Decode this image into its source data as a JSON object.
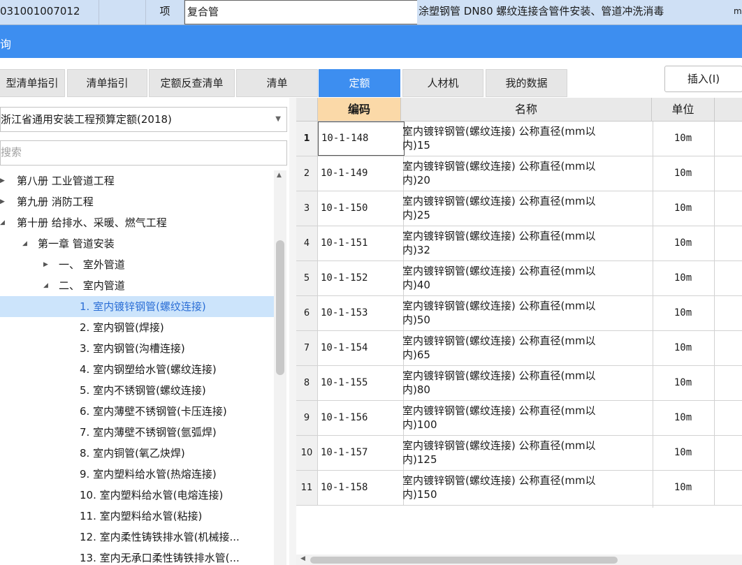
{
  "top_row": {
    "code": "031001007012",
    "blank": "",
    "unit_type": "项",
    "name": "复合管",
    "description": "涂塑钢管 DN80 螺纹连接含管件安装、管道冲洗消毒",
    "extra": "m"
  },
  "title_bar": {
    "title": "询"
  },
  "tabs": [
    {
      "label": "型清单指引"
    },
    {
      "label": "清单指引"
    },
    {
      "label": "定额反查清单"
    },
    {
      "label": "清单"
    },
    {
      "label": "定额"
    },
    {
      "label": "人材机"
    },
    {
      "label": "我的数据"
    }
  ],
  "insert_button": {
    "label": "插入(I)"
  },
  "quota_select": {
    "value": "浙江省通用安装工程预算定额(2018)"
  },
  "search": {
    "placeholder": "搜索"
  },
  "tree": [
    {
      "label": "第八册 工业管道工程",
      "arrow": "▶"
    },
    {
      "label": "第九册 消防工程",
      "arrow": "▶"
    },
    {
      "label": "第十册 给排水、采暖、燃气工程",
      "arrow": "◢"
    },
    {
      "label": "第一章 管道安装",
      "arrow": "◢"
    },
    {
      "label": "一、 室外管道",
      "arrow": "▶"
    },
    {
      "label": "二、 室内管道",
      "arrow": "◢"
    },
    {
      "label": "1. 室内镀锌钢管(螺纹连接)",
      "arrow": ""
    },
    {
      "label": "2. 室内钢管(焊接)",
      "arrow": ""
    },
    {
      "label": "3. 室内钢管(沟槽连接)",
      "arrow": ""
    },
    {
      "label": "4. 室内钢塑给水管(螺纹连接)",
      "arrow": ""
    },
    {
      "label": "5. 室内不锈钢管(螺纹连接)",
      "arrow": ""
    },
    {
      "label": "6. 室内薄壁不锈钢管(卡压连接)",
      "arrow": ""
    },
    {
      "label": "7. 室内薄壁不锈钢管(氩弧焊)",
      "arrow": ""
    },
    {
      "label": "8. 室内铜管(氧乙炔焊)",
      "arrow": ""
    },
    {
      "label": "9. 室内塑料给水管(热熔连接)",
      "arrow": ""
    },
    {
      "label": "10. 室内塑料给水管(电熔连接)",
      "arrow": ""
    },
    {
      "label": "11. 室内塑料给水管(粘接)",
      "arrow": ""
    },
    {
      "label": "12. 室内柔性铸铁排水管(机械接...",
      "arrow": ""
    },
    {
      "label": "13. 室内无承口柔性铸铁排水管(...",
      "arrow": ""
    }
  ],
  "grid": {
    "headers": {
      "num": "",
      "code": "编码",
      "name": "名称",
      "unit": "单位"
    },
    "rows": [
      {
        "num": "1",
        "code": "10-1-148",
        "name_line1": "室内镀锌钢管(螺纹连接) 公称直径(mm以",
        "name_line2": "内)15",
        "unit": "10m"
      },
      {
        "num": "2",
        "code": "10-1-149",
        "name_line1": "室内镀锌钢管(螺纹连接) 公称直径(mm以",
        "name_line2": "内)20",
        "unit": "10m"
      },
      {
        "num": "3",
        "code": "10-1-150",
        "name_line1": "室内镀锌钢管(螺纹连接) 公称直径(mm以",
        "name_line2": "内)25",
        "unit": "10m"
      },
      {
        "num": "4",
        "code": "10-1-151",
        "name_line1": "室内镀锌钢管(螺纹连接) 公称直径(mm以",
        "name_line2": "内)32",
        "unit": "10m"
      },
      {
        "num": "5",
        "code": "10-1-152",
        "name_line1": "室内镀锌钢管(螺纹连接) 公称直径(mm以",
        "name_line2": "内)40",
        "unit": "10m"
      },
      {
        "num": "6",
        "code": "10-1-153",
        "name_line1": "室内镀锌钢管(螺纹连接) 公称直径(mm以",
        "name_line2": "内)50",
        "unit": "10m"
      },
      {
        "num": "7",
        "code": "10-1-154",
        "name_line1": "室内镀锌钢管(螺纹连接) 公称直径(mm以",
        "name_line2": "内)65",
        "unit": "10m"
      },
      {
        "num": "8",
        "code": "10-1-155",
        "name_line1": "室内镀锌钢管(螺纹连接) 公称直径(mm以",
        "name_line2": "内)80",
        "unit": "10m"
      },
      {
        "num": "9",
        "code": "10-1-156",
        "name_line1": "室内镀锌钢管(螺纹连接) 公称直径(mm以",
        "name_line2": "内)100",
        "unit": "10m"
      },
      {
        "num": "10",
        "code": "10-1-157",
        "name_line1": "室内镀锌钢管(螺纹连接) 公称直径(mm以",
        "name_line2": "内)125",
        "unit": "10m"
      },
      {
        "num": "11",
        "code": "10-1-158",
        "name_line1": "室内镀锌钢管(螺纹连接) 公称直径(mm以",
        "name_line2": "内)150",
        "unit": "10m"
      }
    ]
  },
  "colors": {
    "accent": "#3d8ef0",
    "header_highlight": "#fbd9a8",
    "selection": "#cce4fb"
  }
}
